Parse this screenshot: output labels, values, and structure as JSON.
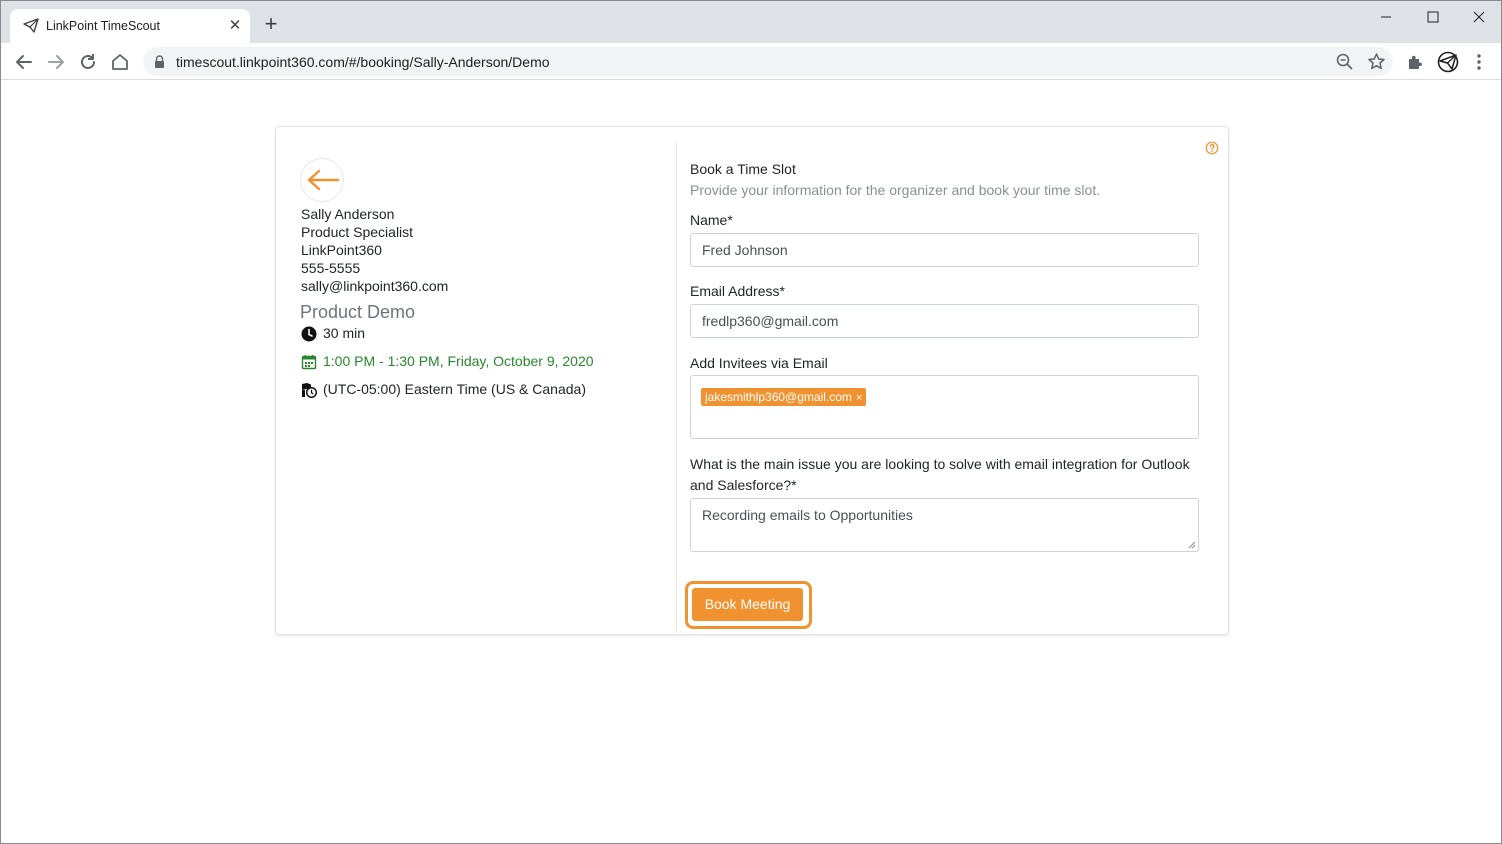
{
  "browser": {
    "tab_title": "LinkPoint TimeScout",
    "tab_close": "✕",
    "new_tab": "+",
    "url": "timescout.linkpoint360.com/#/booking/Sally-Anderson/Demo"
  },
  "organizer": {
    "name": "Sally Anderson",
    "title": "Product Specialist",
    "company": "LinkPoint360",
    "phone": "555-5555",
    "email": "sally@linkpoint360.com"
  },
  "event": {
    "title": "Product Demo",
    "duration": "30 min",
    "time_slot": "1:00 PM - 1:30 PM, Friday, October 9, 2020",
    "timezone": "(UTC-05:00) Eastern Time (US & Canada)"
  },
  "form": {
    "title": "Book a Time Slot",
    "subtitle": "Provide your information for the organizer and book your time slot.",
    "name_label": "Name*",
    "name_value": "Fred Johnson",
    "email_label": "Email Address*",
    "email_value": "fredlp360@gmail.com",
    "invitees_label": "Add Invitees via Email",
    "invitee_tags": [
      "jakesmithlp360@gmail.com"
    ],
    "tag_remove": "×",
    "question_label": "What is the main issue you are looking to solve with email integration for Outlook and Salesforce?*",
    "question_value": "Recording emails to Opportunities",
    "submit_label": "Book Meeting"
  },
  "colors": {
    "accent": "#f0922f",
    "green_text": "#28862e"
  },
  "icons": {
    "favicon": "timescout-logo-icon",
    "back": "arrow-left-icon",
    "duration": "clock-icon",
    "date": "calendar-icon",
    "timezone": "globe-clock-icon",
    "help": "question-circle-icon"
  }
}
